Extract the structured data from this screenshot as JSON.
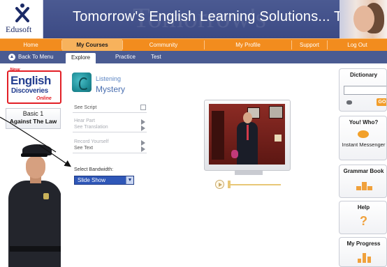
{
  "header": {
    "logo_text": "Edusoft",
    "title": "Tomorrow's English Learning Solutions... Today",
    "logo_icon": "edusoft-x-icon"
  },
  "top_nav": {
    "items": [
      {
        "label": "Home",
        "active": false
      },
      {
        "label": "My Courses",
        "active": true
      },
      {
        "label": "Community",
        "active": false
      },
      {
        "label": "My Profile",
        "active": false
      },
      {
        "label": "Support",
        "active": false
      },
      {
        "label": "Log Out",
        "active": false
      }
    ],
    "accent_color": "#f28c1e"
  },
  "sub_nav": {
    "back_label": "Back To Menu",
    "tabs": [
      {
        "label": "Explore",
        "active": true
      },
      {
        "label": "Practice",
        "active": false
      },
      {
        "label": "Test",
        "active": false
      }
    ],
    "color": "#4a5b92"
  },
  "course": {
    "logo_new": "New",
    "logo_line1": "English",
    "logo_line2": "Discoveries",
    "logo_online": "Online",
    "unit_level": "Basic 1",
    "unit_title": "Against The Law"
  },
  "lesson": {
    "type": "Listening",
    "title": "Mystery"
  },
  "options": [
    {
      "label": "See Script",
      "control": "checkbox",
      "enabled": true
    },
    {
      "label": "Hear Part",
      "control": "play",
      "enabled": false
    },
    {
      "label": "See Translation",
      "control": "none",
      "enabled": false
    },
    {
      "label": "Record Yourself",
      "control": "play",
      "enabled": false
    },
    {
      "label": "See Text",
      "control": "play",
      "enabled": true
    }
  ],
  "bandwidth": {
    "label": "Select Bandwidth:",
    "selected": "Slide Show"
  },
  "video": {
    "play_icon": "play-icon"
  },
  "right_panel": {
    "dictionary_title": "Dictionary",
    "dictionary_go": "GO",
    "you_who_title": "You! Who?",
    "you_who_label": "Instant Messenger",
    "grammar_title": "Grammar Book",
    "help_title": "Help",
    "help_icon_glyph": "?",
    "progress_title": "My Progress"
  }
}
